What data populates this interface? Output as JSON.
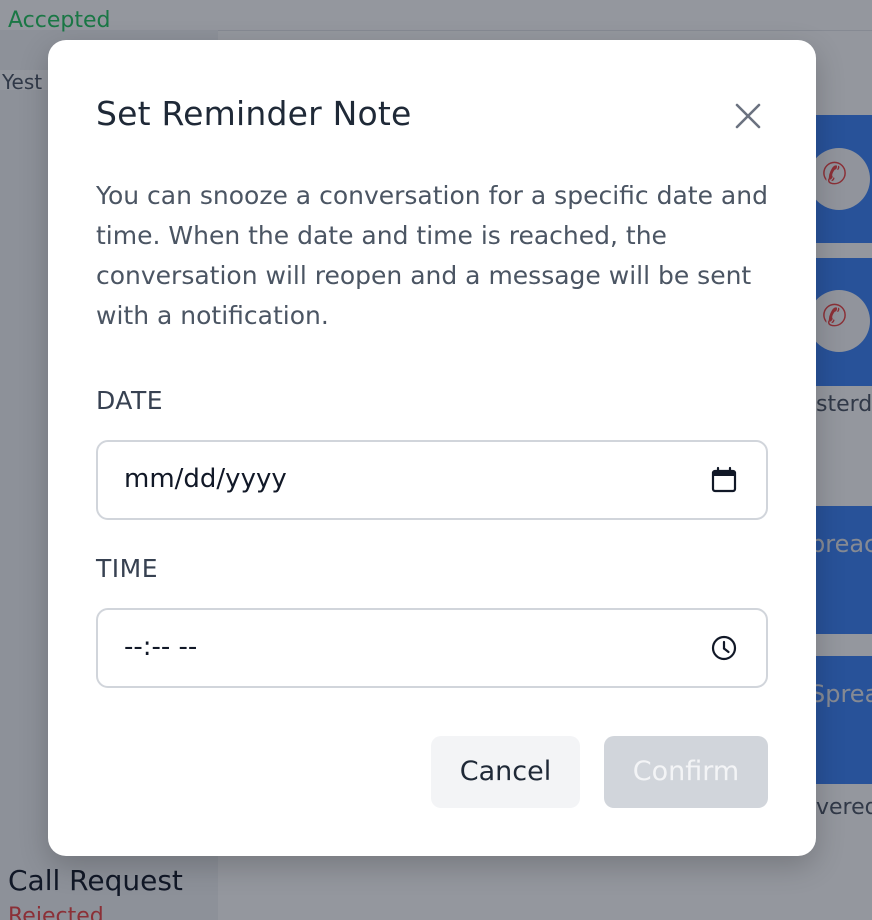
{
  "background": {
    "left_status_top": "Accepted",
    "left_time_top": "Yest",
    "left_bottom_title": "Call Request",
    "left_bottom_status": "Rejected",
    "right_texts": [
      "sterda",
      "preac",
      "Sprea",
      "vered"
    ]
  },
  "modal": {
    "title": "Set Reminder Note",
    "description": "You can snooze a conversation for a specific date and time. When the date and time is reached, the conversation will reopen and a message will be sent with a notification.",
    "date": {
      "label": "DATE",
      "value": "mm/dd/yyyy"
    },
    "time": {
      "label": "TIME",
      "value": "--:-- --"
    },
    "buttons": {
      "cancel": "Cancel",
      "confirm": "Confirm"
    },
    "colors": {
      "overlay": "#111827",
      "confirm_disabled": "#d1d5db",
      "accent_blue": "#3b82f6"
    },
    "icons": {
      "close": "close-icon",
      "date": "calendar-icon",
      "time": "clock-icon",
      "call": "phone-icon"
    }
  }
}
